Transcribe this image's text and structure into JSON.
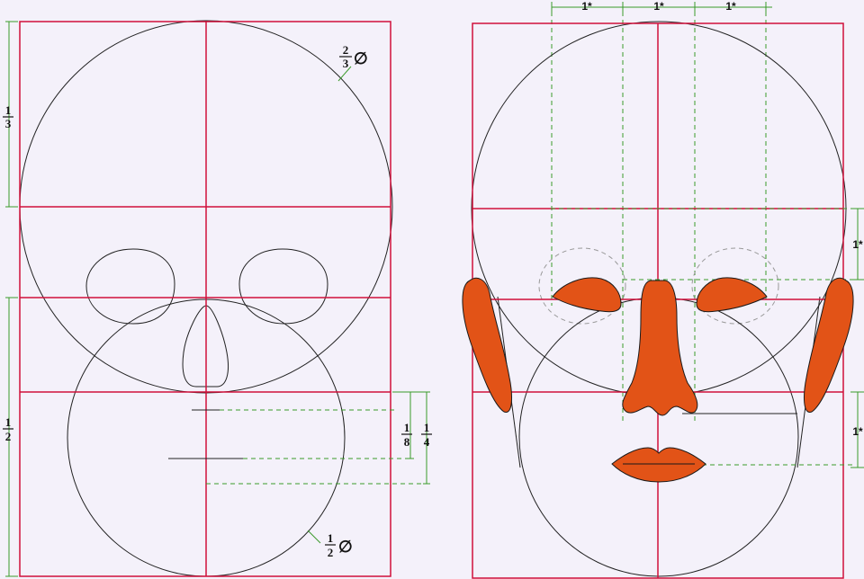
{
  "colors": {
    "background": "#f4f1fa",
    "frame": "#d0103a",
    "guide": "#3a9a2a",
    "feature": "#e25317",
    "outline": "#222222"
  },
  "left_panel": {
    "diameter_fraction": {
      "num": "2",
      "den": "3",
      "symbol": "∅"
    },
    "upper_fraction": {
      "num": "1",
      "den": "3"
    },
    "lower_fraction": {
      "num": "1",
      "den": "2"
    },
    "eighth_fraction": {
      "num": "1",
      "den": "8"
    },
    "quarter_fraction": {
      "num": "1",
      "den": "4"
    },
    "chin_circle_fraction": {
      "num": "1",
      "den": "2",
      "symbol": "∅"
    }
  },
  "right_panel": {
    "unit_label": "1*"
  }
}
